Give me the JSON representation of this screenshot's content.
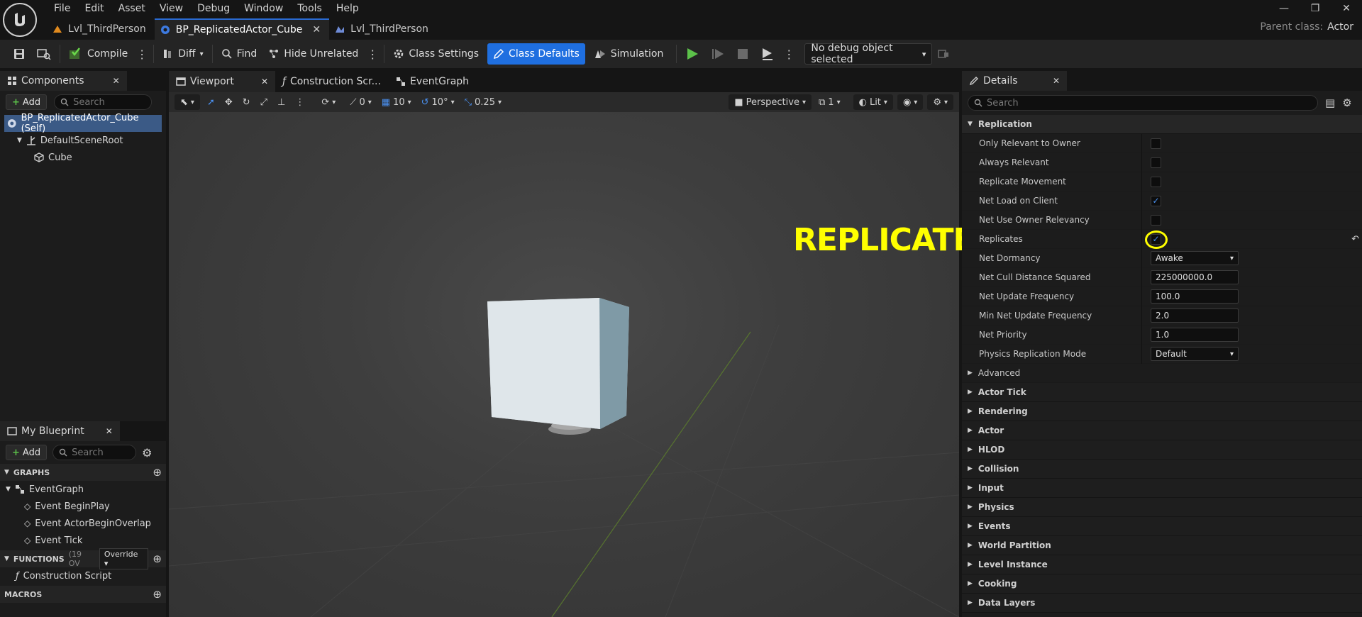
{
  "menu": [
    "File",
    "Edit",
    "Asset",
    "View",
    "Debug",
    "Window",
    "Tools",
    "Help"
  ],
  "doc_tabs": [
    {
      "label": "Lvl_ThirdPerson",
      "active": false
    },
    {
      "label": "BP_ReplicatedActor_Cube",
      "active": true
    },
    {
      "label": "Lvl_ThirdPerson",
      "active": false
    }
  ],
  "parent_class": {
    "label": "Parent class:",
    "value": "Actor"
  },
  "toolbar": {
    "compile": "Compile",
    "diff": "Diff",
    "find": "Find",
    "hide_unrelated": "Hide Unrelated",
    "class_settings": "Class Settings",
    "class_defaults": "Class Defaults",
    "simulation": "Simulation",
    "debug_object": "No debug object selected"
  },
  "components_panel": {
    "title": "Components",
    "add": "Add",
    "search_placeholder": "Search",
    "items": [
      "BP_ReplicatedActor_Cube (Self)",
      "DefaultSceneRoot",
      "Cube"
    ]
  },
  "my_blueprint": {
    "title": "My Blueprint",
    "add": "Add",
    "search_placeholder": "Search",
    "graphs_header": "GRAPHS",
    "graphs": [
      "EventGraph",
      "Event BeginPlay",
      "Event ActorBeginOverlap",
      "Event Tick"
    ],
    "functions_header": "FUNCTIONS",
    "functions_count": "(19 OV",
    "override": "Override",
    "functions": [
      "Construction Script"
    ],
    "macros_header": "MACROS"
  },
  "editor_tabs": [
    "Viewport",
    "Construction Scr...",
    "EventGraph"
  ],
  "viewport_toolbar": {
    "rotation_snap": "0",
    "grid": "10",
    "angle": "10°",
    "scale": "0.25",
    "perspective": "Perspective",
    "layers": "1",
    "lit": "Lit"
  },
  "annotation": "REPLICATES",
  "details": {
    "title": "Details",
    "search_placeholder": "Search",
    "section": "Replication",
    "props": [
      {
        "name": "Only Relevant to Owner",
        "type": "checkbox",
        "checked": false
      },
      {
        "name": "Always Relevant",
        "type": "checkbox",
        "checked": false
      },
      {
        "name": "Replicate Movement",
        "type": "checkbox",
        "checked": false
      },
      {
        "name": "Net Load on Client",
        "type": "checkbox",
        "checked": true
      },
      {
        "name": "Net Use Owner Relevancy",
        "type": "checkbox",
        "checked": false
      },
      {
        "name": "Replicates",
        "type": "checkbox",
        "checked": true
      },
      {
        "name": "Net Dormancy",
        "type": "dropdown",
        "value": "Awake"
      },
      {
        "name": "Net Cull Distance Squared",
        "type": "number",
        "value": "225000000.0"
      },
      {
        "name": "Net Update Frequency",
        "type": "number",
        "value": "100.0"
      },
      {
        "name": "Min Net Update Frequency",
        "type": "number",
        "value": "2.0"
      },
      {
        "name": "Net Priority",
        "type": "number",
        "value": "1.0"
      },
      {
        "name": "Physics Replication Mode",
        "type": "dropdown",
        "value": "Default"
      }
    ],
    "subsection": "Advanced",
    "categories": [
      "Actor Tick",
      "Rendering",
      "Actor",
      "HLOD",
      "Collision",
      "Input",
      "Physics",
      "Events",
      "World Partition",
      "Level Instance",
      "Cooking",
      "Data Layers"
    ]
  },
  "colors": {
    "accent": "#1f6fe0",
    "highlight": "#ffff00",
    "checkmark": "#4a90f0"
  }
}
